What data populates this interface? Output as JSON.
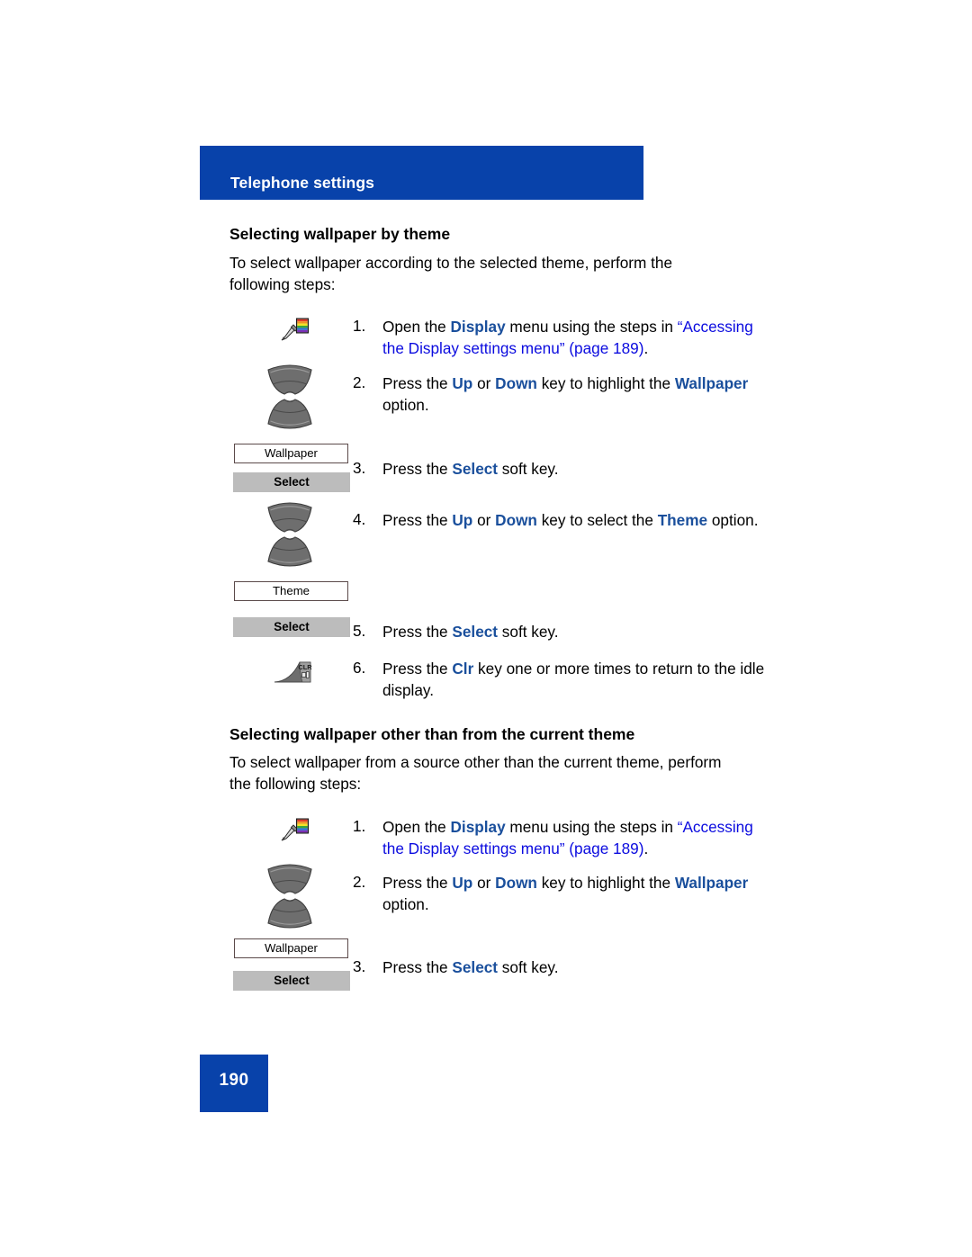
{
  "header": {
    "title": "Telephone settings"
  },
  "sections": [
    {
      "heading": "Selecting wallpaper by theme",
      "intro": "To select wallpaper according to the selected theme, perform the following steps:",
      "steps": [
        {
          "num": "1.",
          "icon": "display-settings-icon",
          "text_parts": [
            {
              "t": "Open the ",
              "style": "plain"
            },
            {
              "t": "Display",
              "style": "keyword"
            },
            {
              "t": " menu using the steps in ",
              "style": "plain"
            },
            {
              "t": "“Accessing the Display settings menu” (page 189)",
              "style": "xref"
            },
            {
              "t": ".",
              "style": "plain"
            }
          ]
        },
        {
          "num": "2.",
          "icon": "navigation-rocker-icon",
          "text_parts": [
            {
              "t": "Press the ",
              "style": "plain"
            },
            {
              "t": "Up",
              "style": "keyword"
            },
            {
              "t": " or ",
              "style": "plain"
            },
            {
              "t": "Down",
              "style": "keyword"
            },
            {
              "t": " key to highlight the ",
              "style": "plain"
            },
            {
              "t": "Wallpaper",
              "style": "keyword"
            },
            {
              "t": " option.",
              "style": "plain"
            }
          ]
        },
        {
          "num": "3.",
          "icon": "lcd-and-softkey",
          "lcd_label": "Wallpaper",
          "softkey_label": "Select",
          "text_parts": [
            {
              "t": "Press the ",
              "style": "plain"
            },
            {
              "t": "Select",
              "style": "keyword"
            },
            {
              "t": " soft key.",
              "style": "plain"
            }
          ]
        },
        {
          "num": "4.",
          "icon": "navigation-rocker-icon",
          "lcd_label": "Theme",
          "text_parts": [
            {
              "t": "Press the ",
              "style": "plain"
            },
            {
              "t": "Up",
              "style": "keyword"
            },
            {
              "t": " or ",
              "style": "plain"
            },
            {
              "t": "Down",
              "style": "keyword"
            },
            {
              "t": " key to select the ",
              "style": "plain"
            },
            {
              "t": "Theme",
              "style": "keyword"
            },
            {
              "t": " option.",
              "style": "plain"
            }
          ]
        },
        {
          "num": "5.",
          "icon": "softkey",
          "softkey_label": "Select",
          "text_parts": [
            {
              "t": "Press the ",
              "style": "plain"
            },
            {
              "t": "Select",
              "style": "keyword"
            },
            {
              "t": " soft key.",
              "style": "plain"
            }
          ]
        },
        {
          "num": "6.",
          "icon": "clr-key-icon",
          "icon_label": "CLR",
          "text_parts": [
            {
              "t": "Press the ",
              "style": "plain"
            },
            {
              "t": "Clr",
              "style": "keyword"
            },
            {
              "t": " key one or more times to return to the idle display.",
              "style": "plain"
            }
          ]
        }
      ]
    },
    {
      "heading": "Selecting wallpaper other than from the current theme",
      "intro": "To select wallpaper from a source other than the current theme, perform the following steps:",
      "steps": [
        {
          "num": "1.",
          "icon": "display-settings-icon",
          "text_parts": [
            {
              "t": "Open the ",
              "style": "plain"
            },
            {
              "t": "Display",
              "style": "keyword"
            },
            {
              "t": " menu using the steps in ",
              "style": "plain"
            },
            {
              "t": "“Accessing the Display settings menu” (page 189)",
              "style": "xref"
            },
            {
              "t": ".",
              "style": "plain"
            }
          ]
        },
        {
          "num": "2.",
          "icon": "navigation-rocker-icon",
          "text_parts": [
            {
              "t": "Press the ",
              "style": "plain"
            },
            {
              "t": "Up",
              "style": "keyword"
            },
            {
              "t": " or ",
              "style": "plain"
            },
            {
              "t": "Down",
              "style": "keyword"
            },
            {
              "t": " key to highlight the ",
              "style": "plain"
            },
            {
              "t": "Wallpaper",
              "style": "keyword"
            },
            {
              "t": " option.",
              "style": "plain"
            }
          ]
        },
        {
          "num": "3.",
          "icon": "lcd-and-softkey",
          "lcd_label": "Wallpaper",
          "softkey_label": "Select",
          "text_parts": [
            {
              "t": "Press the ",
              "style": "plain"
            },
            {
              "t": "Select",
              "style": "keyword"
            },
            {
              "t": " soft key.",
              "style": "plain"
            }
          ]
        }
      ]
    }
  ],
  "footer": {
    "page_number": "190"
  },
  "labels": {
    "lcd_wallpaper_1": "Wallpaper",
    "lcd_theme": "Theme",
    "lcd_wallpaper_2": "Wallpaper",
    "softkey_select_1": "Select",
    "softkey_select_2": "Select",
    "softkey_select_3": "Select",
    "clr_key": "CLR",
    "step_1_1": "1.",
    "step_1_2": "2.",
    "step_1_3": "3.",
    "step_1_4": "4.",
    "step_1_5": "5.",
    "step_1_6": "6.",
    "step_2_1": "1.",
    "step_2_2": "2.",
    "step_2_3": "3."
  },
  "colors": {
    "banner_blue": "#0842aa",
    "keyword_blue": "#1a4f9c",
    "xref_blue": "#0b0bdf",
    "softkey_gray": "#bcbcbc",
    "lcd_border": "#5b4a4a"
  }
}
